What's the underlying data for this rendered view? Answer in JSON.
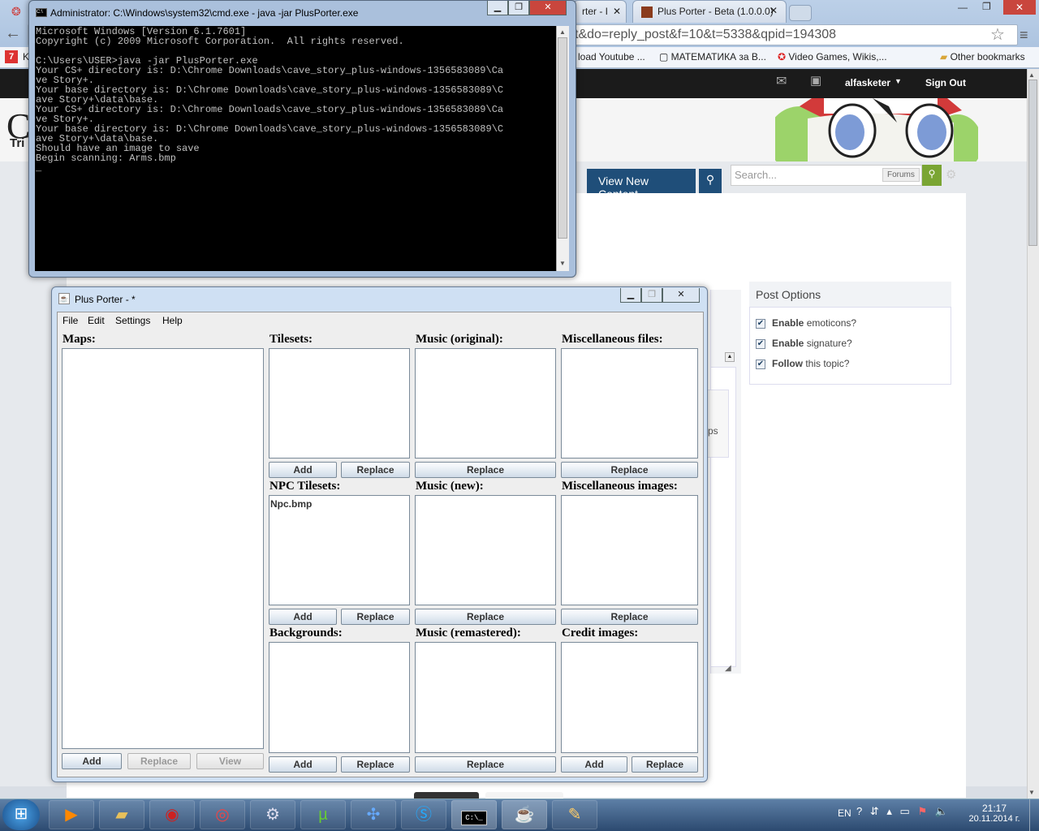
{
  "browser": {
    "tabs": [
      {
        "label": "rter - I"
      },
      {
        "label": "Plus Porter - Beta (1.0.0.0)"
      }
    ],
    "url": "t&do=reply_post&f=10&t=5338&qpid=194308",
    "bookmarks": [
      {
        "label": "K"
      },
      {
        "label": "load Youtube ..."
      },
      {
        "label": "МАТЕМАТИКА за В..."
      },
      {
        "label": "Video Games, Wikis,..."
      },
      {
        "label": "Other bookmarks"
      }
    ]
  },
  "site": {
    "user": "alfasketer",
    "sign_out": "Sign Out",
    "logo_partial": "C",
    "logo_sub": "Tri",
    "view_new_content": "View New Content",
    "search_placeholder": "Search...",
    "search_scope": "Forums",
    "behind_text": "ps",
    "post_options": {
      "title": "Post Options",
      "items": [
        {
          "bold": "Enable",
          "rest": " emoticons?",
          "checked": true
        },
        {
          "bold": "Enable",
          "rest": " signature?",
          "checked": true
        },
        {
          "bold": "Follow",
          "rest": " this topic?",
          "checked": true
        }
      ]
    }
  },
  "cmd": {
    "title": "Administrator: C:\\Windows\\system32\\cmd.exe - java  -jar PlusPorter.exe",
    "icon_label": "C:\\",
    "output": "Microsoft Windows [Version 6.1.7601]\nCopyright (c) 2009 Microsoft Corporation.  All rights reserved.\n\nC:\\Users\\USER>java -jar PlusPorter.exe\nYour CS+ directory is: D:\\Chrome Downloads\\cave_story_plus-windows-1356583089\\Ca\nve Story+.\nYour base directory is: D:\\Chrome Downloads\\cave_story_plus-windows-1356583089\\C\nave Story+\\data\\base.\nYour CS+ directory is: D:\\Chrome Downloads\\cave_story_plus-windows-1356583089\\Ca\nve Story+.\nYour base directory is: D:\\Chrome Downloads\\cave_story_plus-windows-1356583089\\C\nave Story+\\data\\base.\nShould have an image to save\nBegin scanning: Arms.bmp\n_"
  },
  "porter": {
    "title": "Plus Porter - *",
    "menu": [
      "File",
      "Edit",
      "Settings",
      "Help"
    ],
    "maps": {
      "label": "Maps:",
      "add": "Add",
      "replace": "Replace",
      "view": "View"
    },
    "tilesets": {
      "label": "Tilesets:",
      "add": "Add",
      "replace": "Replace"
    },
    "music_original": {
      "label": "Music (original):",
      "replace": "Replace"
    },
    "misc_files": {
      "label": "Miscellaneous files:",
      "replace": "Replace"
    },
    "npc_tilesets": {
      "label": "NPC Tilesets:",
      "items": [
        "Npc.bmp"
      ],
      "add": "Add",
      "replace": "Replace"
    },
    "music_new": {
      "label": "Music (new):",
      "replace": "Replace"
    },
    "misc_images": {
      "label": "Miscellaneous images:",
      "replace": "Replace"
    },
    "backgrounds": {
      "label": "Backgrounds:",
      "add": "Add",
      "replace": "Replace"
    },
    "music_remastered": {
      "label": "Music (remastered):",
      "replace": "Replace"
    },
    "credit_images": {
      "label": "Credit images:",
      "add": "Add",
      "replace": "Replace"
    }
  },
  "taskbar": {
    "lang": "EN",
    "time": "21:17",
    "date": "20.11.2014 г.",
    "cmd_label": "C:\\_"
  }
}
